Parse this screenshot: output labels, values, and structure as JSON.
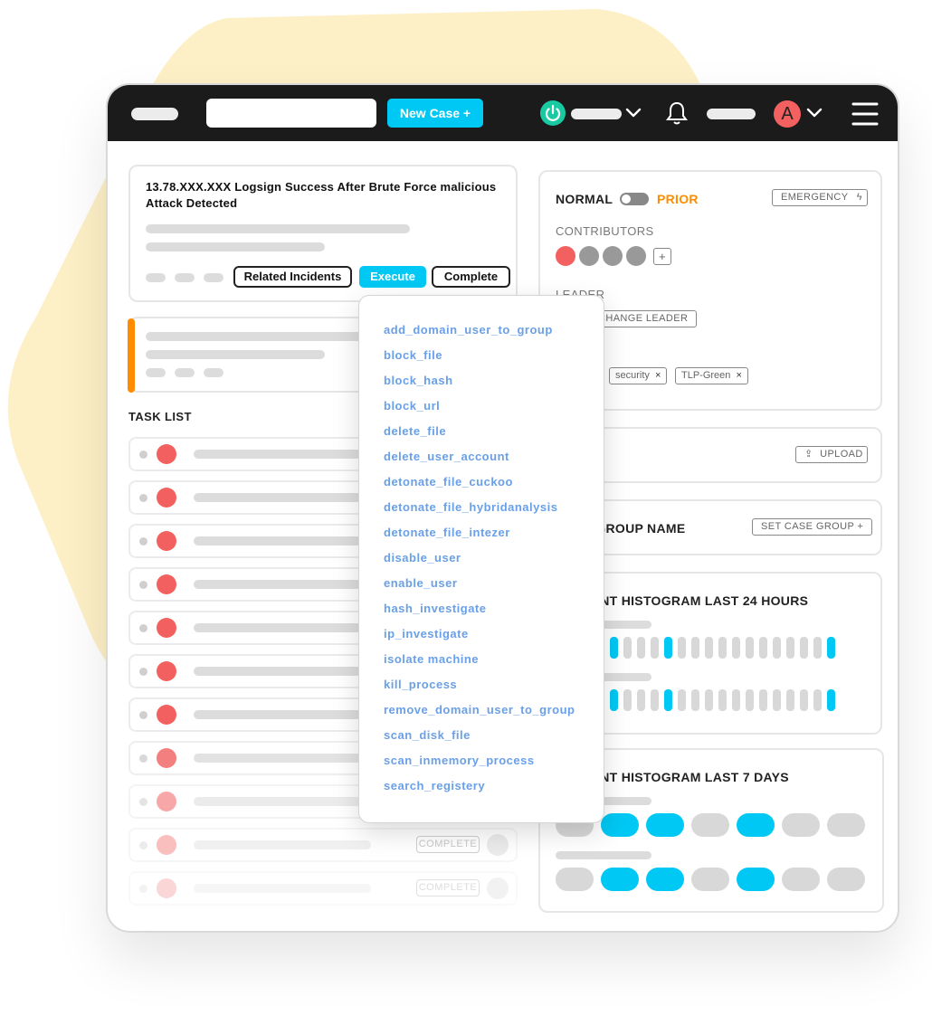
{
  "colors": {
    "accent": "#00c8f4",
    "danger": "#f26060",
    "warning": "#ff8c00",
    "topbar": "#1b1b1b",
    "link": "#6aa0e8",
    "success": "#19c9a2"
  },
  "topbar": {
    "new_case_label": "New Case +",
    "avatar_initial": "A"
  },
  "incident": {
    "title": "13.78.XXX.XXX Logsign Success After Brute Force malicious Attack Detected",
    "related_label": "Related Incidents",
    "execute_label": "Execute",
    "complete_label": "Complete"
  },
  "task_list": {
    "title": "TASK LIST",
    "complete_label": "COMPLETE",
    "rows": [
      {
        "opacity": 1
      },
      {
        "opacity": 1
      },
      {
        "opacity": 1
      },
      {
        "opacity": 1
      },
      {
        "opacity": 1
      },
      {
        "opacity": 1
      },
      {
        "opacity": 1
      },
      {
        "opacity": 0.8
      },
      {
        "opacity": 0.55
      },
      {
        "opacity": 0.4
      },
      {
        "opacity": 0.25
      }
    ]
  },
  "dropdown": {
    "items": [
      "add_domain_user_to_group",
      "block_file",
      "block_hash",
      "block_url",
      "delete_file",
      "delete_user_account",
      "detonate_file_cuckoo",
      "detonate_file_hybridanalysis",
      "detonate_file_intezer",
      "disable_user",
      "enable_user",
      "hash_investigate",
      "ip_investigate",
      "isolate machine",
      "kill_process",
      "remove_domain_user_to_group",
      "scan_disk_file",
      "scan_inmemory_process",
      "search_registery"
    ]
  },
  "priority": {
    "normal_label": "NORMAL",
    "prior_label": "PRIOR",
    "emergency_label": "EMERGENCY"
  },
  "contributors": {
    "title": "CONTRIBUTORS",
    "add_label": "+"
  },
  "leader": {
    "title": "LEADER",
    "change_label": "CHANGE LEADER"
  },
  "tags": [
    "security",
    "TLP-Green"
  ],
  "upload": {
    "label": "UPLOAD"
  },
  "case_group": {
    "title": "CASE GROUP NAME",
    "set_label": "SET CASE GROUP +"
  },
  "histogram_24h": {
    "title": "INCIDENT HISTOGRAM LAST 24 HOURS",
    "rows": [
      [
        0,
        0,
        1,
        0,
        1,
        0,
        0,
        0,
        1,
        0,
        0,
        0,
        0,
        0,
        0,
        0,
        0,
        0,
        0,
        0,
        1
      ],
      [
        0,
        0,
        1,
        0,
        1,
        0,
        0,
        0,
        1,
        0,
        0,
        0,
        0,
        0,
        0,
        0,
        0,
        0,
        0,
        0,
        1
      ]
    ]
  },
  "histogram_7d": {
    "title": "INCIDENT HISTOGRAM LAST 7 DAYS",
    "rows": [
      [
        0,
        1,
        1,
        0,
        1,
        0,
        0
      ],
      [
        0,
        1,
        1,
        0,
        1,
        0,
        0
      ]
    ]
  }
}
